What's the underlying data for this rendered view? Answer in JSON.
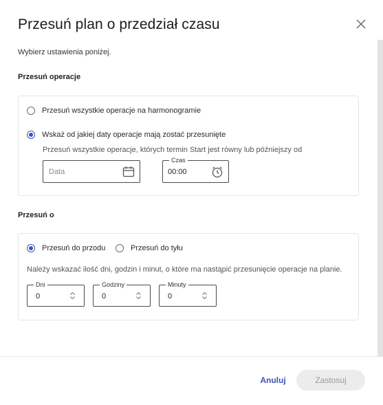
{
  "dialog": {
    "title": "Przesuń plan o przedział czasu",
    "subtitle": "Wybierz ustawienia poniżej.",
    "close_icon": "close-icon"
  },
  "shift_operations": {
    "heading": "Przesuń operacje",
    "options": [
      {
        "label": "Przesuń wszystkie operacje na harmonogramie",
        "checked": false
      },
      {
        "label": "Wskaż od jakiej daty operacje mają zostać przesunięte",
        "checked": true
      }
    ],
    "hint": "Przesuń wszystkie operacje, których termin Start jest równy lub późniejszy od",
    "date_field": {
      "placeholder": "Data",
      "value": "",
      "icon": "calendar-icon"
    },
    "time_field": {
      "label": "Czas",
      "value": "00:00",
      "icon": "clock-icon"
    }
  },
  "shift_by": {
    "heading": "Przesuń o",
    "directions": [
      {
        "label": "Przesuń do przodu",
        "checked": true
      },
      {
        "label": "Przesuń do tyłu",
        "checked": false
      }
    ],
    "hint": "Należy wskazać ilość dni, godzin i minut, o które ma nastąpić przesunięcie operacje na planie.",
    "days": {
      "label": "Dni",
      "value": "0"
    },
    "hours": {
      "label": "Godziny",
      "value": "0"
    },
    "minutes": {
      "label": "Minuty",
      "value": "0"
    }
  },
  "footer": {
    "cancel_label": "Anuluj",
    "apply_label": "Zastosuj",
    "apply_enabled": false
  },
  "colors": {
    "accent": "#3f51b5",
    "border": "#e6e6e6",
    "disabled_bg": "#ececec",
    "disabled_text": "#9a9a9a"
  }
}
